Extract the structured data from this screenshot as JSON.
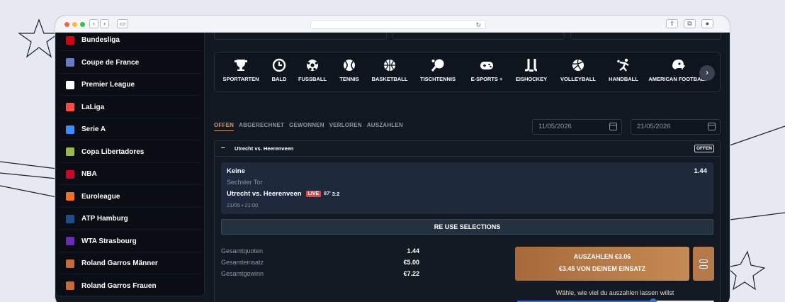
{
  "sidebar": {
    "items": [
      {
        "label": "Bundesliga",
        "icon": "bundesliga-icon",
        "color": "#d20515"
      },
      {
        "label": "Coupe de France",
        "icon": "coupe-de-france-icon",
        "color": "#6b7cc4"
      },
      {
        "label": "Premier League",
        "icon": "premier-league-icon",
        "color": "#ffffff"
      },
      {
        "label": "LaLiga",
        "icon": "laliga-icon",
        "color": "#ff4b44"
      },
      {
        "label": "Serie A",
        "icon": "serie-a-icon",
        "color": "#3c8dff"
      },
      {
        "label": "Copa Libertadores",
        "icon": "copa-libertadores-icon",
        "color": "#9bb84a"
      },
      {
        "label": "NBA",
        "icon": "nba-icon",
        "color": "#c9082a"
      },
      {
        "label": "Euroleague",
        "icon": "euroleague-icon",
        "color": "#f36f21"
      },
      {
        "label": "ATP Hamburg",
        "icon": "atp-icon",
        "color": "#1d4e89"
      },
      {
        "label": "WTA Strasbourg",
        "icon": "wta-icon",
        "color": "#6a2cb5"
      },
      {
        "label": "Roland Garros Männer",
        "icon": "roland-garros-icon",
        "color": "#c86a3a"
      },
      {
        "label": "Roland Garros Frauen",
        "icon": "roland-garros-icon",
        "color": "#c86a3a"
      }
    ]
  },
  "sports": [
    {
      "label": "SPORTARTEN",
      "icon": "trophy-icon"
    },
    {
      "label": "BALD",
      "icon": "clock-icon"
    },
    {
      "label": "FUSSBALL",
      "icon": "soccer-ball-icon"
    },
    {
      "label": "TENNIS",
      "icon": "tennis-ball-icon"
    },
    {
      "label": "BASKETBALL",
      "icon": "basketball-icon"
    },
    {
      "label": "TISCHTENNIS",
      "icon": "ping-pong-icon"
    },
    {
      "label": "E-SPORTS +",
      "icon": "gamepad-icon"
    },
    {
      "label": "EISHOCKEY",
      "icon": "hockey-icon"
    },
    {
      "label": "VOLLEYBALL",
      "icon": "volleyball-icon"
    },
    {
      "label": "HANDBALL",
      "icon": "handball-icon"
    },
    {
      "label": "AMERICAN FOOTBALL",
      "icon": "football-helmet-icon"
    }
  ],
  "tabs": [
    "OFFEN",
    "ABGERECHNET",
    "GEWONNEN",
    "VERLOREN",
    "AUSZAHLEN"
  ],
  "filters": {
    "date_from": "11/05/2026",
    "date_to": "21/05/2026"
  },
  "bet": {
    "collapse_symbol": "–",
    "title": "Utrecht vs. Heerenveen",
    "status": "OFFEN",
    "selection": {
      "pick": "Keine",
      "odds": "1.44",
      "market": "Sechster Tor",
      "match": "Utrecht vs. Heerenveen",
      "live_label": "LIVE",
      "minute": "87'",
      "score": "3:2",
      "datetime": "21/05 • 21:00"
    },
    "reuse_label": "RE USE SELECTIONS",
    "summary": [
      {
        "label": "Gesamtquoten",
        "value": "1.44"
      },
      {
        "label": "Gesamteinsatz",
        "value": "€5.00"
      },
      {
        "label": "Gesamtgewinn",
        "value": "€7.22"
      }
    ],
    "cashout": {
      "line1": "AUSZAHLEN €3.06",
      "line2": "€3.45 VON DEINEM EINSATZ"
    },
    "slider": {
      "label": "Wähle, wie viel du auszahlen lassen willst",
      "value_fraction": 0.69
    }
  },
  "colors": {
    "accent": "#d99b5d",
    "cashout": "#b7794a",
    "live": "#e24545",
    "slider": "#2f72e6"
  }
}
